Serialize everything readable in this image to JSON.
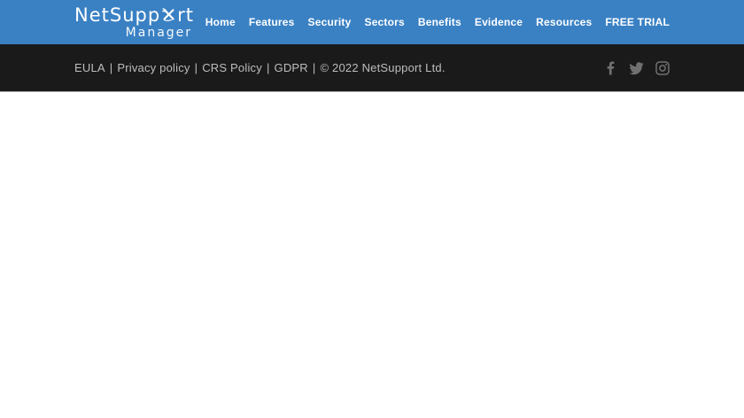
{
  "brand": {
    "name_prefix": "NetSupp",
    "name_suffix": "rt",
    "subtitle": "Manager"
  },
  "nav": {
    "items": [
      {
        "label": "Home"
      },
      {
        "label": "Features"
      },
      {
        "label": "Security"
      },
      {
        "label": "Sectors"
      },
      {
        "label": "Benefits"
      },
      {
        "label": "Evidence"
      },
      {
        "label": "Resources"
      },
      {
        "label": "FREE TRIAL"
      }
    ]
  },
  "footer": {
    "links": [
      {
        "label": "EULA"
      },
      {
        "label": "Privacy policy"
      },
      {
        "label": "CRS Policy"
      },
      {
        "label": "GDPR"
      }
    ],
    "separator": "|",
    "copyright": "© 2022 NetSupport Ltd.",
    "social": [
      {
        "name": "facebook"
      },
      {
        "name": "twitter"
      },
      {
        "name": "instagram"
      }
    ]
  },
  "colors": {
    "header_bg": "#3a81c4",
    "nav_text": "#ffffff",
    "footer_bg": "#1a1a1a",
    "footer_text": "#bdbdbd",
    "footer_border": "#a6a6a6",
    "social_icon": "#707070"
  }
}
